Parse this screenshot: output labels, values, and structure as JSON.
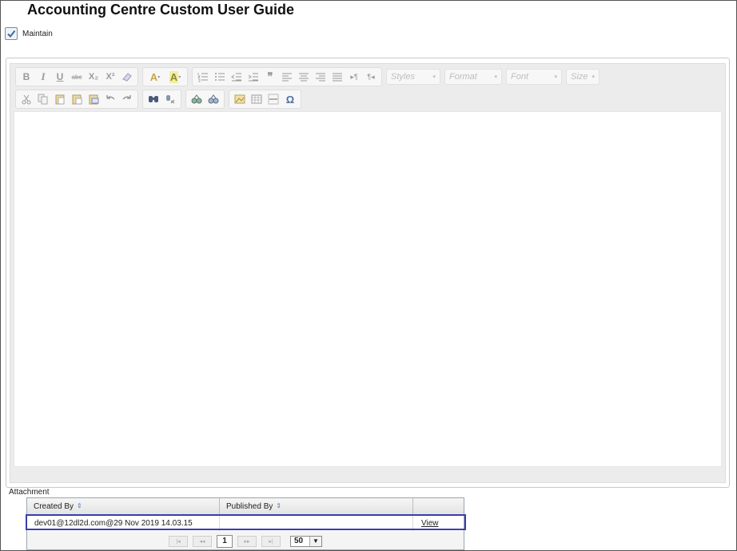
{
  "page": {
    "title": "Accounting Centre Custom User Guide"
  },
  "maintain": {
    "label": "Maintain",
    "checked": true
  },
  "toolbar": {
    "row1": [
      "bold-icon",
      "italic-icon",
      "underline-icon",
      "strikethrough-icon",
      "subscript-icon",
      "superscript-icon",
      "remove-format-icon",
      "text-color-icon",
      "background-color-icon",
      "numbered-list-icon",
      "bulleted-list-icon",
      "decrease-indent-icon",
      "increase-indent-icon",
      "blockquote-icon",
      "align-left-icon",
      "align-center-icon",
      "align-right-icon",
      "justify-icon",
      "ltr-icon",
      "rtl-icon"
    ],
    "bold": "B",
    "italic": "I",
    "underline": "U",
    "strike": "abc",
    "subscript": "X₂",
    "superscript": "X²",
    "text_color": "A",
    "bg_color": "A",
    "combos": {
      "styles": "Styles",
      "format": "Format",
      "font": "Font",
      "size": "Size"
    }
  },
  "attachment": {
    "label": "Attachment",
    "columns": [
      "Created By",
      "Published By",
      ""
    ],
    "rows": [
      {
        "created_by": "dev01@12dl2d.com@29 Nov 2019 14.03.15",
        "published_by": "",
        "action": "View"
      }
    ],
    "pager": {
      "current_page": "1",
      "page_size": "50"
    }
  }
}
